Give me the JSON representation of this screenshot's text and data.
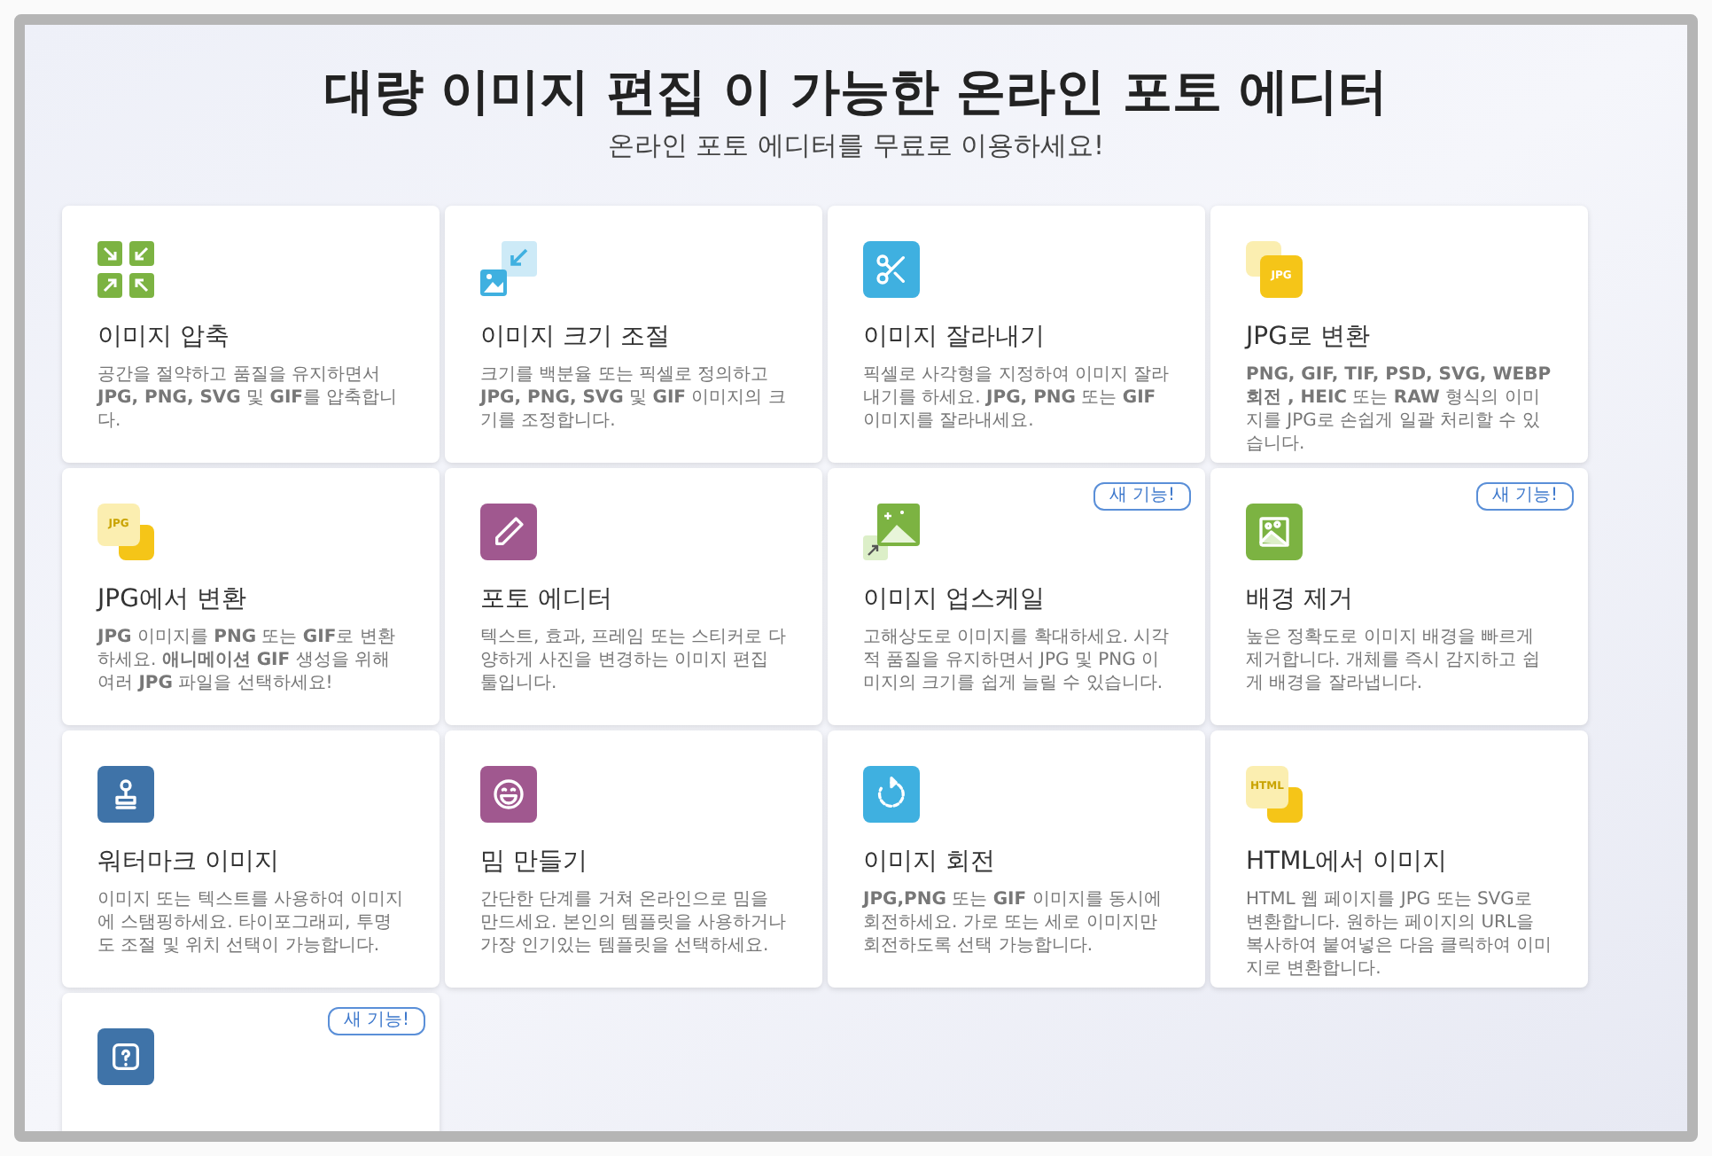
{
  "title": "대량 이미지 편집 이 가능한 온라인 포토 에디터",
  "subtitle": "온라인 포토 에디터를 무료로 이용하세요!",
  "tools": [
    {
      "kind": "compress",
      "color": "#7cb342",
      "title": "이미지 압축",
      "description": "공간을 절약하고 품질을 유지하면서 **JPG, PNG, SVG** 및 **GIF**를 압축합니다."
    },
    {
      "kind": "resize",
      "color": "#3fb0e0",
      "title": "이미지 크기 조절",
      "description": "크기를 백분율 또는 픽셀로 정의하고 **JPG, PNG, SVG** 및 **GIF** 이미지의 크기를 조정합니다."
    },
    {
      "kind": "crop",
      "color": "#3fb0e0",
      "title": "이미지 잘라내기",
      "description": "픽셀로 사각형을 지정하여 이미지 잘라내기를 하세요. **JPG, PNG** 또는 **GIF** 이미지를 잘라내세요."
    },
    {
      "kind": "to-jpg",
      "color": "#f5c518",
      "icon_text": "JPG",
      "title": "JPG로 변환",
      "description": "**PNG, GIF, TIF, PSD, SVG, WEBP 회전 , HEIC** 또는 **RAW** 형식의 이미지를 JPG로 손쉽게 일괄 처리할 수 있습니다."
    },
    {
      "kind": "from-jpg",
      "color": "#f5c518",
      "icon_text": "JPG",
      "title": "JPG에서 변환",
      "description": "**JPG** 이미지를 **PNG** 또는 **GIF**로 변환하세요. **애니메이션 GIF** 생성을 위해 여러 **JPG** 파일을 선택하세요!"
    },
    {
      "kind": "edit",
      "color": "#a0588f",
      "title": "포토 에디터",
      "description": "텍스트, 효과, 프레임 또는 스티커로 다양하게 사진을 변경하는 이미지 편집 툴입니다."
    },
    {
      "kind": "upscale",
      "color": "#7cb342",
      "title": "이미지 업스케일",
      "description": "고해상도로 이미지를 확대하세요. 시각적 품질을 유지하면서 JPG 및 PNG 이미지의 크기를 쉽게 늘릴 수 있습니다.",
      "new_badge": "새 기능!"
    },
    {
      "kind": "remove-bg",
      "color": "#7cb342",
      "title": "배경 제거",
      "description": "높은 정확도로 이미지 배경을 빠르게 제거합니다. 개체를 즉시 감지하고 쉽게 배경을 잘라냅니다.",
      "new_badge": "새 기능!"
    },
    {
      "kind": "watermark",
      "color": "#3f73a8",
      "title": "워터마크 이미지",
      "description": "이미지 또는 텍스트를 사용하여 이미지에 스탬핑하세요. 타이포그래피, 투명도 조절 및 위치 선택이 가능합니다."
    },
    {
      "kind": "meme",
      "color": "#a0588f",
      "title": "밈 만들기",
      "description": "간단한 단계를 거쳐 온라인으로 밈을 만드세요. 본인의 템플릿을 사용하거나 가장 인기있는 템플릿을 선택하세요."
    },
    {
      "kind": "rotate",
      "color": "#3fb0e0",
      "title": "이미지 회전",
      "description": "**JPG,PNG** 또는 **GIF** 이미지를 동시에 회전하세요. 가로 또는 세로 이미지만 회전하도록 선택 가능합니다."
    },
    {
      "kind": "html",
      "color": "#f5c518",
      "icon_text": "HTML",
      "title": "HTML에서 이미지",
      "description": "HTML 웹 페이지를 JPG 또는 SVG로 변환합니다. 원하는 페이지의 URL을 복사하여 붙여넣은 다음 클릭하여 이미지로 변환합니다."
    },
    {
      "kind": "blur-face",
      "color": "#3f73a8",
      "new_badge": "새 기능!"
    }
  ]
}
